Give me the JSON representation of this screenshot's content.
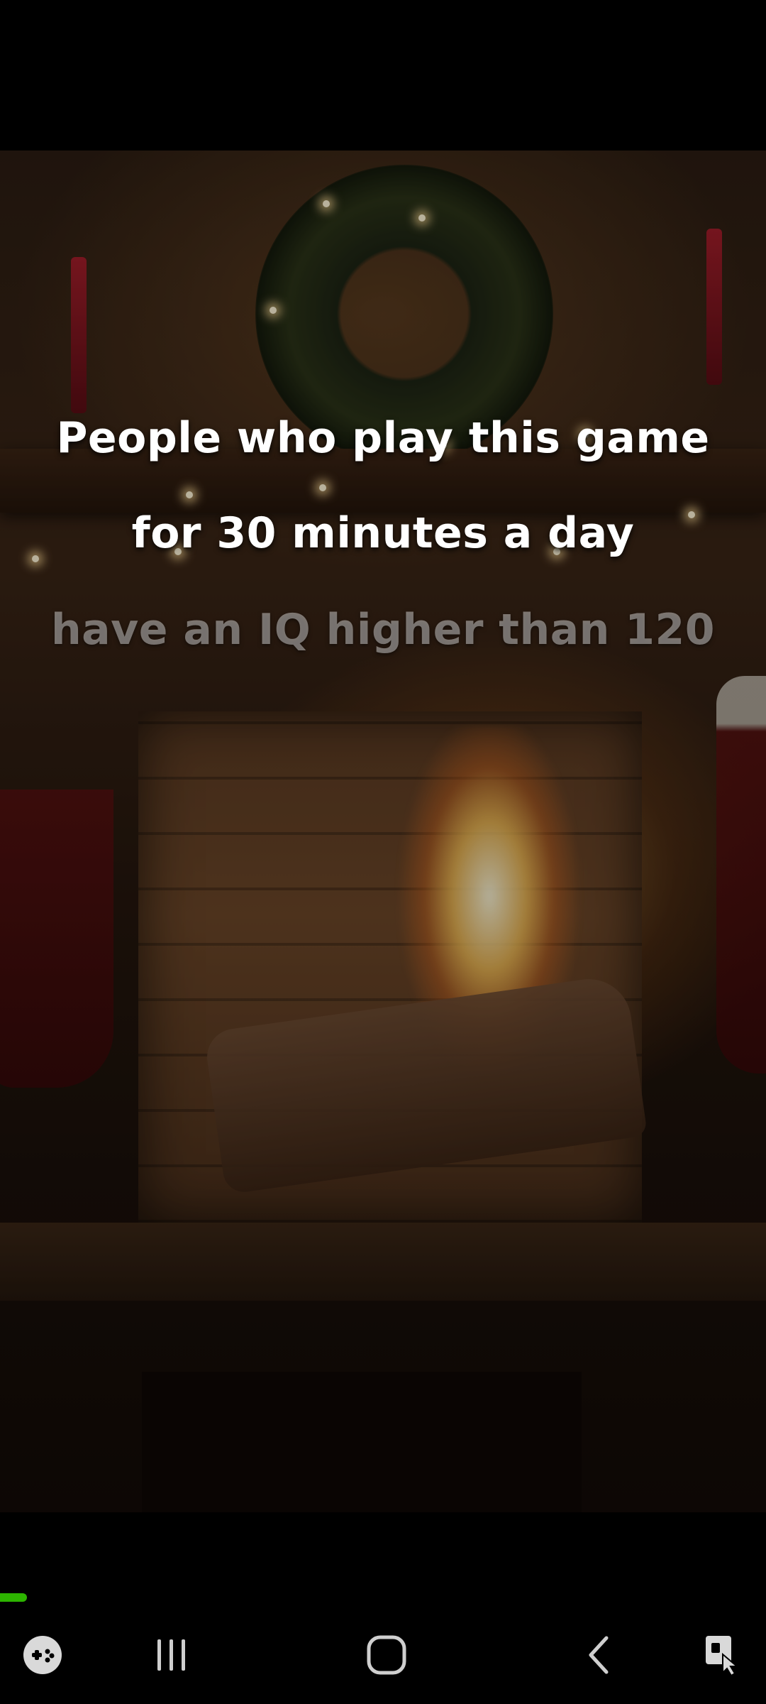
{
  "video": {
    "caption_lines": [
      "People who play this game",
      "for 30 minutes a day",
      "have an IQ higher than 120"
    ],
    "progress_fraction": 0.035,
    "progress_color": "#2db400"
  },
  "nav_bar": {
    "buttons": [
      {
        "name": "game-launcher-icon"
      },
      {
        "name": "recent-apps-icon"
      },
      {
        "name": "home-icon"
      },
      {
        "name": "back-icon"
      },
      {
        "name": "screenshot-tool-icon"
      }
    ]
  }
}
